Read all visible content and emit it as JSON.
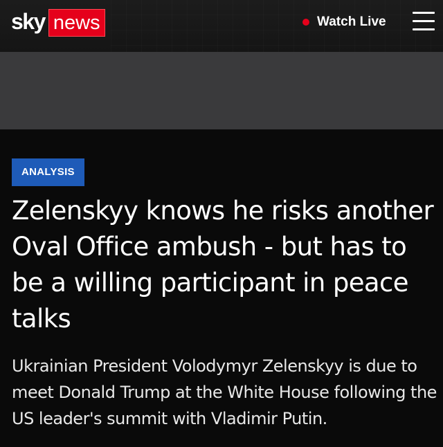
{
  "header": {
    "logo_sky": "sky",
    "logo_news": "news",
    "watch_live_label": "Watch Live",
    "menu_icon": "hamburger-menu-icon",
    "colors": {
      "brand_red": "#e5001b",
      "header_bg": "#1c1c1c"
    }
  },
  "article": {
    "category_badge": "ANALYSIS",
    "headline": "Zelenskyy knows he risks another Oval Office ambush - but has to be a willing participant in peace talks",
    "standfirst": "Ukrainian President Volodymyr Zelenskyy is due to meet Donald Trump at the White House following the US leader's summit with Vladimir Putin.",
    "colors": {
      "badge_bg": "#1e5bb8",
      "page_bg": "#0a0a0a",
      "ad_band_bg": "#3a3a3c"
    }
  }
}
